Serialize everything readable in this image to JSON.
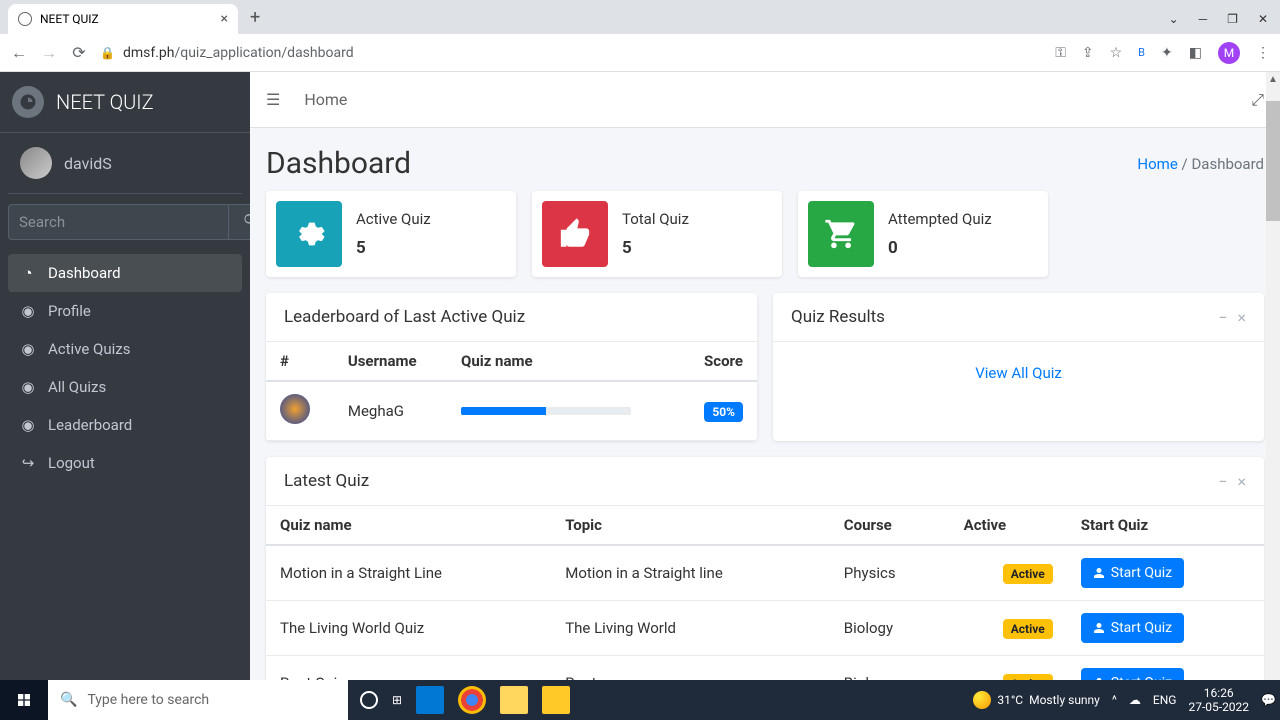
{
  "browser": {
    "tab_title": "NEET QUIZ",
    "url_host": "dmsf.ph",
    "url_path": "/quiz_application/dashboard",
    "profile_initial": "M",
    "bookmark_initial": "B"
  },
  "sidebar": {
    "brand": "NEET QUIZ",
    "user": "davidS",
    "search_placeholder": "Search",
    "items": [
      {
        "label": "Dashboard"
      },
      {
        "label": "Profile"
      },
      {
        "label": "Active Quizs"
      },
      {
        "label": "All Quizs"
      },
      {
        "label": "Leaderboard"
      },
      {
        "label": "Logout"
      }
    ]
  },
  "topbar": {
    "home": "Home"
  },
  "header": {
    "title": "Dashboard",
    "crumb_home": "Home",
    "crumb_here": "Dashboard"
  },
  "stats": [
    {
      "label": "Active Quiz",
      "value": "5"
    },
    {
      "label": "Total Quiz",
      "value": "5"
    },
    {
      "label": "Attempted Quiz",
      "value": "0"
    }
  ],
  "leaderboard": {
    "title": "Leaderboard of Last Active Quiz",
    "cols": [
      "#",
      "Username",
      "Quiz name",
      "Score"
    ],
    "rows": [
      {
        "user": "MeghaG",
        "progress": 50,
        "score": "50%"
      }
    ]
  },
  "results": {
    "title": "Quiz Results",
    "view_all": "View All Quiz"
  },
  "latest": {
    "title": "Latest Quiz",
    "cols": [
      "Quiz name",
      "Topic",
      "Course",
      "Active",
      "Start Quiz"
    ],
    "rows": [
      {
        "name": "Motion in a Straight Line",
        "topic": "Motion in a Straight line",
        "course": "Physics",
        "status": "Active",
        "btn": "Start Quiz"
      },
      {
        "name": "The Living World Quiz",
        "topic": "The Living World",
        "course": "Biology",
        "status": "Active",
        "btn": "Start Quiz"
      },
      {
        "name": "Root Quiz",
        "topic": "Root",
        "course": "Biology",
        "status": "Active",
        "btn": "Start Quiz"
      }
    ]
  },
  "taskbar": {
    "search_placeholder": "Type here to search",
    "temp": "31°C",
    "weather": "Mostly sunny",
    "lang": "ENG",
    "time": "16:26",
    "date": "27-05-2022"
  }
}
